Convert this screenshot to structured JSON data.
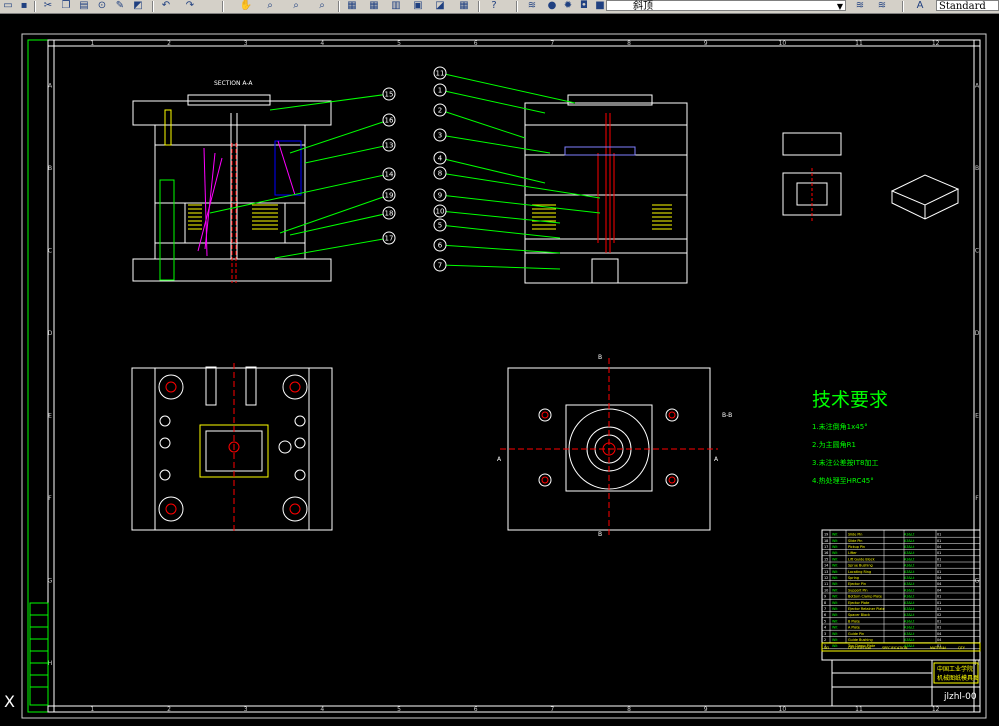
{
  "toolbar": {
    "layer_name": "斜顶",
    "text_style": "Standard",
    "icons": [
      "cut-icon",
      "copy-icon",
      "paste-icon",
      "match-icon",
      "undo-icon",
      "redo-icon",
      "pan-icon",
      "zoom-realtime-icon",
      "zoom-window-icon",
      "zoom-previous-icon",
      "properties-icon",
      "designcenter-icon",
      "toolpalette-icon",
      "sheetset-icon",
      "markup-icon",
      "calc-icon",
      "help-icon",
      "layer-manager-icon",
      "layer-bulb-icon",
      "layer-sun-icon",
      "layer-lock-icon",
      "layer-color-icon",
      "make-current-icon",
      "layer-previous-icon",
      "textstyle-icon"
    ]
  },
  "frame": {
    "columns": [
      "1",
      "2",
      "3",
      "4",
      "5",
      "6",
      "7",
      "8",
      "9",
      "10",
      "11",
      "12"
    ],
    "rows": [
      "A",
      "B",
      "C",
      "D",
      "E",
      "F",
      "G",
      "H"
    ]
  },
  "section_label": "SECTION A-A",
  "balloons_left": [
    "15",
    "16",
    "13",
    "14",
    "19",
    "18",
    "17"
  ],
  "balloons_right": [
    "11",
    "1",
    "2",
    "3",
    "4",
    "8",
    "9",
    "10",
    "5",
    "6",
    "7"
  ],
  "section_marks": {
    "top": "B",
    "bottom": "B",
    "left": "A",
    "right": "A",
    "side": "B-B"
  },
  "tech_req": {
    "title": "技术要求",
    "items": [
      "1.未注倒角1x45°",
      "2.为主圆角R1",
      "3.未注公差按IT8加工",
      "4.热处理至HRC45°"
    ]
  },
  "bom_rows": [
    [
      "19",
      "Wit",
      "Slide Pin",
      "A3&Lt",
      "01"
    ],
    [
      "18",
      "Wit",
      "Slide Pin",
      "A3&Lt",
      "01"
    ],
    [
      "17",
      "Wit",
      "Pickup Pin",
      "A3&Lt",
      "04"
    ],
    [
      "16",
      "Wit",
      "Lifter",
      "A3&Lt",
      "01"
    ],
    [
      "15",
      "Wit",
      "Lift Guide Block",
      "A3&Lt",
      "01"
    ],
    [
      "14",
      "Wit",
      "Sprue Bushing",
      "A3&Lt",
      "01"
    ],
    [
      "13",
      "Wit",
      "Locating Ring",
      "A3&Lt",
      "01"
    ],
    [
      "12",
      "Wit",
      "Spring",
      "A3&Lt",
      "04"
    ],
    [
      "11",
      "Wit",
      "Ejector Pin",
      "A3&Lt",
      "04"
    ],
    [
      "10",
      "Wit",
      "Support Pin",
      "A3&Lt",
      "04"
    ],
    [
      "9",
      "Wit",
      "Bottom Clamp Plate",
      "A3&Lt",
      "01"
    ],
    [
      "8",
      "Wit",
      "Ejector Plate",
      "A3&Lt",
      "01"
    ],
    [
      "7",
      "Wit",
      "Ejector Retainer Plate",
      "A3&Lt",
      "01"
    ],
    [
      "6",
      "Wit",
      "Spacer Block",
      "A3&Lt",
      "02"
    ],
    [
      "5",
      "Wit",
      "B Plate",
      "A3&Lt",
      "01"
    ],
    [
      "4",
      "Wit",
      "A Plate",
      "A3&Lt",
      "01"
    ],
    [
      "3",
      "Wit",
      "Guide Pin",
      "A3&Lt",
      "04"
    ],
    [
      "2",
      "Wit",
      "Guide Bushing",
      "A3&Lt",
      "04"
    ],
    [
      "1",
      "Wit",
      "Top Clamp Plate",
      "A3&Lt",
      "01"
    ]
  ],
  "bom_header": [
    "NO.",
    "DESCRIPTION",
    "SPECIFICATION",
    "MATERIAL",
    "QTY"
  ],
  "title_block": {
    "school": "中国工业学院",
    "title": "机械图纸模具图",
    "drawing_no": "jlzhl-00"
  },
  "ucs_label": "X"
}
